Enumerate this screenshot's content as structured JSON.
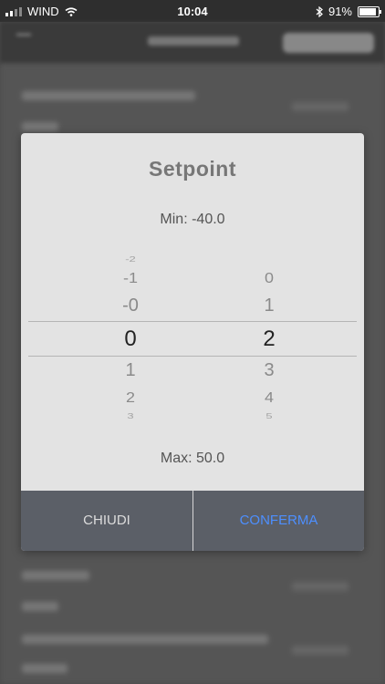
{
  "status_bar": {
    "carrier": "WIND",
    "time": "10:04",
    "battery": "91%"
  },
  "dialog": {
    "title": "Setpoint",
    "min_label": "Min: -40.0",
    "max_label": "Max: 50.0",
    "integer_column": [
      "-2",
      "-1",
      "-0",
      "0",
      "1",
      "2",
      "3"
    ],
    "decimal_column": [
      "0",
      "1",
      "2",
      "3",
      "4",
      "5"
    ],
    "selected_integer": "0",
    "selected_decimal": "2",
    "close_label": "CHIUDI",
    "confirm_label": "CONFERMA",
    "confirm_color": "#4d8fff"
  }
}
